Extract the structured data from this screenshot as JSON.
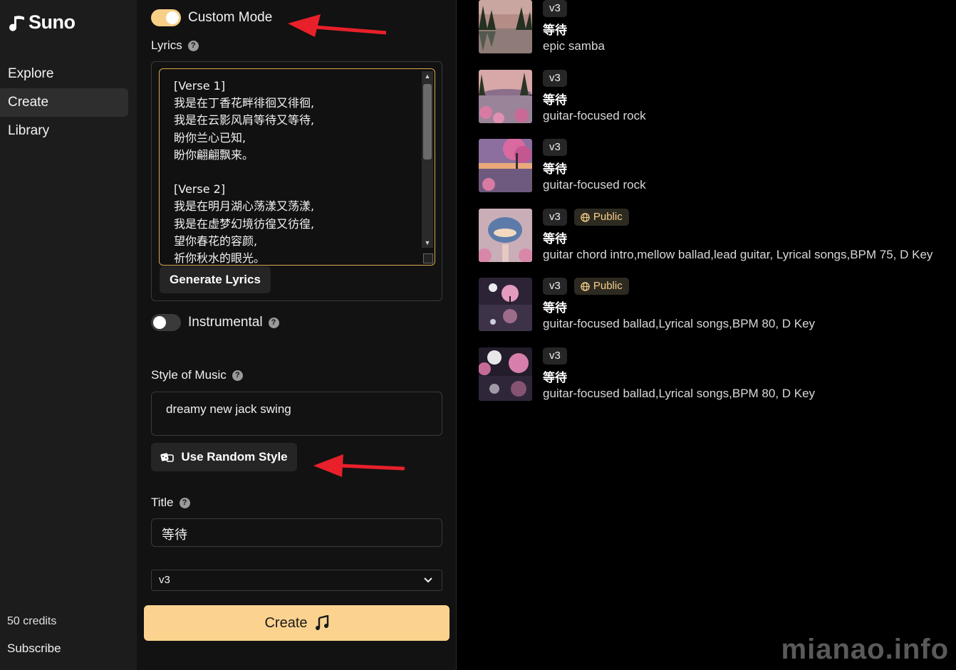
{
  "app": {
    "name": "Suno"
  },
  "sidebar": {
    "items": [
      {
        "label": "Explore"
      },
      {
        "label": "Create"
      },
      {
        "label": "Library"
      }
    ],
    "credits": "50 credits",
    "subscribe": "Subscribe"
  },
  "form": {
    "custom_mode": {
      "label": "Custom Mode",
      "on": true
    },
    "lyrics": {
      "label": "Lyrics",
      "value": "[Verse 1]\n我是在丁香花畔徘徊又徘徊,\n我是在云影风肩等待又等待,\n盼你兰心已知,\n盼你翩翩飘来。\n\n[Verse 2]\n我是在明月湖心荡漾又荡漾,\n我是在虚梦幻境彷徨又彷徨,\n望你春花的容颜,\n祈你秋水的眼光。",
      "generate_button": "Generate Lyrics"
    },
    "instrumental": {
      "label": "Instrumental",
      "on": false
    },
    "style": {
      "label": "Style of Music",
      "value": "dreamy new jack swing",
      "random_button": "Use Random Style"
    },
    "title": {
      "label": "Title",
      "value": "等待"
    },
    "model": {
      "value": "v3"
    },
    "create_button": "Create"
  },
  "songs": [
    {
      "version": "v3",
      "public": "",
      "title": "等待",
      "style": "epic samba",
      "thumb": "lake-forest"
    },
    {
      "version": "v3",
      "public": "",
      "title": "等待",
      "style": "guitar-focused rock",
      "thumb": "lake-blossom"
    },
    {
      "version": "v3",
      "public": "",
      "title": "等待",
      "style": "guitar-focused rock",
      "thumb": "tree-sunset"
    },
    {
      "version": "v3",
      "public": "Public",
      "title": "等待",
      "style": "guitar chord intro,mellow ballad,lead guitar, Lyrical songs,BPM 75, D Key",
      "thumb": "cloud-portal"
    },
    {
      "version": "v3",
      "public": "Public",
      "title": "等待",
      "style": "guitar-focused ballad,Lyrical songs,BPM 80, D Key",
      "thumb": "moon-tree"
    },
    {
      "version": "v3",
      "public": "",
      "title": "等待",
      "style": "guitar-focused ballad,Lyrical songs,BPM 80, D Key",
      "thumb": "moon-blossom"
    }
  ],
  "watermark": "mianao.info",
  "colors": {
    "accent": "#f8cf86",
    "create_button": "#fbd38f",
    "annotation_arrow": "#e8202a"
  }
}
